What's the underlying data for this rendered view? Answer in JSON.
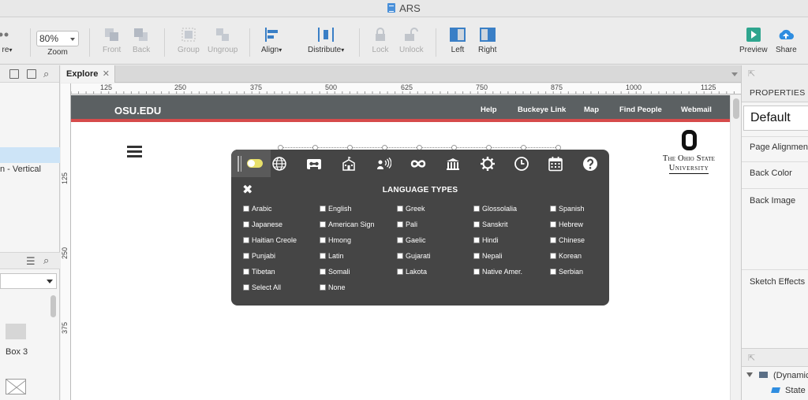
{
  "window": {
    "title": "ARS"
  },
  "toolbar": {
    "partial_left_label": "re",
    "zoom_value": "80%",
    "zoom_label": "Zoom",
    "front": "Front",
    "back": "Back",
    "group": "Group",
    "ungroup": "Ungroup",
    "align": "Align",
    "distribute": "Distribute",
    "lock": "Lock",
    "unlock": "Unlock",
    "left": "Left",
    "right": "Right",
    "preview": "Preview",
    "share": "Share"
  },
  "left_panel": {
    "item_vertical": "n - Vertical",
    "box3_label": "Box 3"
  },
  "tabs": [
    {
      "label": "Explore",
      "close": "✕"
    }
  ],
  "ruler": {
    "top": [
      "125",
      "250",
      "375",
      "500",
      "625",
      "750",
      "875",
      "1000",
      "1125"
    ],
    "left": [
      "125",
      "250",
      "375"
    ]
  },
  "site": {
    "logo": "OSU.EDU",
    "links": [
      "Help",
      "Buckeye Link",
      "Map",
      "Find People",
      "Webmail"
    ],
    "university_line1": "The Ohio State",
    "university_line2": "University"
  },
  "panel": {
    "title": "LANGUAGE TYPES",
    "close": "✖",
    "icons": [
      "toggle-switch-icon",
      "globe-icon",
      "cassette-icon",
      "school-building-icon",
      "speaker-person-icon",
      "infinity-icon",
      "library-icon",
      "gear-icon",
      "clock-icon",
      "calendar-icon",
      "help-circle-icon"
    ],
    "columns": [
      [
        "Arabic",
        "Japanese",
        "Haitian Creole",
        "Punjabi",
        "Tibetan",
        "Select All"
      ],
      [
        "English",
        "American Sign",
        "Hmong",
        "Latin",
        "Somali",
        "None"
      ],
      [
        "Greek",
        "Pali",
        "Gaelic",
        "Gujarati",
        "Lakota"
      ],
      [
        "Glossolalia",
        "Sanskrit",
        "Hindi",
        "Nepali",
        "Native Amer."
      ],
      [
        "Spanish",
        "Hebrew",
        "Chinese",
        "Korean",
        "Serbian"
      ]
    ]
  },
  "right_panel": {
    "header": "PROPERTIES",
    "style_value": "Default",
    "rows": [
      "Page Alignment",
      "Back Color",
      "Back Image",
      "Sketch Effects"
    ],
    "tree": [
      "(Dynamic",
      "State"
    ]
  },
  "colors": {
    "header_bg": "#5b6062",
    "accent_red": "#d64b4b",
    "panel_bg": "#454545",
    "toggle_yellow": "#e8e06a",
    "toolbar_blue": "#4a90d9"
  }
}
